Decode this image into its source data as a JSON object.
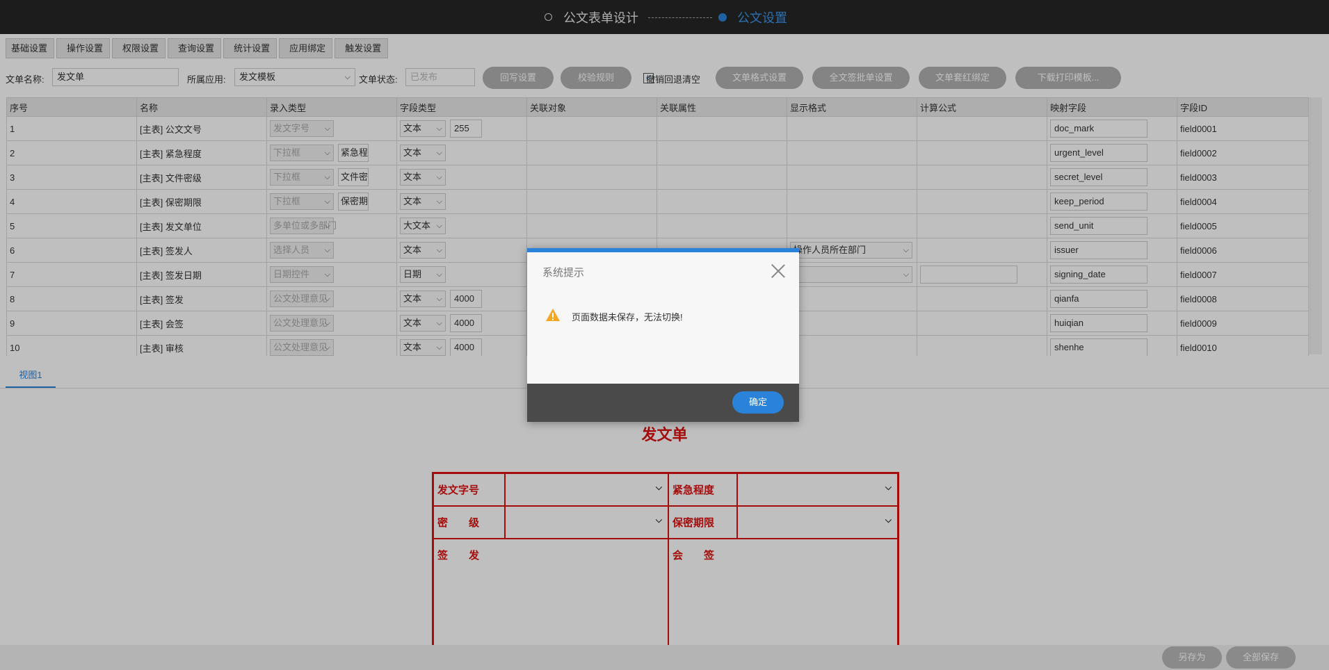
{
  "steps": {
    "step1": "公文表单设计",
    "step2": "公文设置"
  },
  "tabs": [
    "基础设置",
    "操作设置",
    "权限设置",
    "查询设置",
    "统计设置",
    "应用绑定",
    "触发设置"
  ],
  "form": {
    "name_label": "文单名称:",
    "name_value": "发文单",
    "app_label": "所属应用:",
    "app_value": "发文模板",
    "status_label": "文单状态:",
    "status_placeholder": "已发布",
    "btn_writeback": "回写设置",
    "btn_validation": "校验规则",
    "checkbox_label": "撤销回退清空",
    "btn_format": "文单格式设置",
    "btn_sign": "全文签批单设置",
    "btn_redhead": "文单套红绑定",
    "btn_print": "下载打印模板..."
  },
  "table": {
    "headers": [
      "序号",
      "名称",
      "录入类型",
      "字段类型",
      "关联对象",
      "关联属性",
      "显示格式",
      "计算公式",
      "映射字段",
      "字段ID"
    ],
    "rows": [
      {
        "no": "1",
        "name": "[主表] 公文文号",
        "input": "发文字号",
        "extra": "",
        "ftype": "文本",
        "len": "255",
        "display": "",
        "formula": false,
        "map": "doc_mark",
        "id": "field0001"
      },
      {
        "no": "2",
        "name": "[主表] 紧急程度",
        "input": "下拉框",
        "extra": "紧急程",
        "ftype": "文本",
        "len": "",
        "display": "",
        "formula": false,
        "map": "urgent_level",
        "id": "field0002"
      },
      {
        "no": "3",
        "name": "[主表] 文件密级",
        "input": "下拉框",
        "extra": "文件密",
        "ftype": "文本",
        "len": "",
        "display": "",
        "formula": false,
        "map": "secret_level",
        "id": "field0003"
      },
      {
        "no": "4",
        "name": "[主表] 保密期限",
        "input": "下拉框",
        "extra": "保密期",
        "ftype": "文本",
        "len": "",
        "display": "",
        "formula": false,
        "map": "keep_period",
        "id": "field0004"
      },
      {
        "no": "5",
        "name": "[主表] 发文单位",
        "input": "多单位或多部门",
        "extra": "",
        "ftype": "大文本",
        "len": "",
        "display": "",
        "formula": false,
        "map": "send_unit",
        "id": "field0005"
      },
      {
        "no": "6",
        "name": "[主表] 签发人",
        "input": "选择人员",
        "extra": "",
        "ftype": "文本",
        "len": "",
        "display": "操作人员所在部门",
        "formula": false,
        "map": "issuer",
        "id": "field0006"
      },
      {
        "no": "7",
        "name": "[主表] 签发日期",
        "input": "日期控件",
        "extra": "",
        "ftype": "日期",
        "len": "",
        "display": " ",
        "formula": true,
        "map": "signing_date",
        "id": "field0007"
      },
      {
        "no": "8",
        "name": "[主表] 签发",
        "input": "公文处理意见",
        "extra": "",
        "ftype": "文本",
        "len": "4000",
        "display": "",
        "formula": false,
        "map": "qianfa",
        "id": "field0008"
      },
      {
        "no": "9",
        "name": "[主表] 会签",
        "input": "公文处理意见",
        "extra": "",
        "ftype": "文本",
        "len": "4000",
        "display": "",
        "formula": false,
        "map": "huiqian",
        "id": "field0009"
      },
      {
        "no": "10",
        "name": "[主表] 审核",
        "input": "公文处理意见",
        "extra": "",
        "ftype": "文本",
        "len": "4000",
        "display": "",
        "formula": false,
        "map": "shenhe",
        "id": "field0010"
      }
    ]
  },
  "view": {
    "tab": "视图1",
    "doc_title": "发文单",
    "labels": {
      "doc_no": "发文字号",
      "urgency": "紧急程度",
      "secret": "密　　级",
      "period": "保密期限",
      "sign": "签　　发",
      "countersign": "会　　签"
    }
  },
  "footer": {
    "save_as": "另存为",
    "save_all": "全部保存"
  },
  "modal": {
    "title": "系统提示",
    "message": "页面数据未保存，无法切换!",
    "ok": "确定"
  },
  "colors": {
    "accent": "#2a83d8",
    "doc_red": "#dd1111",
    "warn": "#f5a623"
  }
}
